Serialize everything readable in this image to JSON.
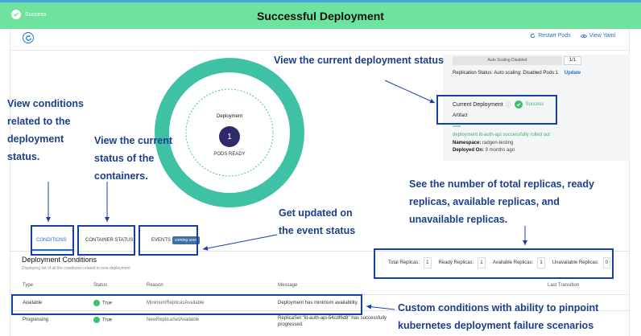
{
  "banner": {
    "status": "Success",
    "title": "Successful Deployment",
    "color": "#6ee3a0"
  },
  "toolbar": {
    "restart_pods": "Restart Pods",
    "view_yaml": "View Yaml"
  },
  "ring": {
    "label": "Deployment",
    "count": "1",
    "sublabel": "PODS READY",
    "color": "#3fc1a6"
  },
  "side": {
    "autoscaling": "Auto Scaling Disabled",
    "ratio": "1/1",
    "replication_status": "Replication Status: Auto scaling: Disabled Pods:1",
    "update": "Update",
    "current_deployment": "Current Deployment",
    "success": "Success",
    "artifact": "Artifact",
    "rolled_out": "deployment lit-auth-api successfully rolled out",
    "namespace_label": "Namespace:",
    "namespace_value": " radgen-testing",
    "deployed_on_label": "Deployed On:",
    "deployed_on_value": " 9 months ago"
  },
  "tabs": {
    "conditions": "CONDITIONS",
    "container_status": "CONTAINER STATUS",
    "events": "EVENTS",
    "coming_soon": "coming soon"
  },
  "conditions": {
    "title": "Deployment Conditions",
    "subtitle": "Displaying list of all the conditions related to new deployment"
  },
  "stats": {
    "total_label": "Total Replicas:",
    "total": "1",
    "ready_label": "Ready Replicas:",
    "ready": "1",
    "available_label": "Available Replicas:",
    "available": "1",
    "unavailable_label": "Unavailable Replicas:",
    "unavailable": "0"
  },
  "table": {
    "headers": [
      "Type",
      "Status",
      "Reason",
      "Message",
      "Last Transition"
    ],
    "rows": [
      {
        "type": "Available",
        "status": "True",
        "reason": "MinimumReplicasAvailable",
        "message": "Deployment has minimum availability."
      },
      {
        "type": "Progressing",
        "status": "True",
        "reason": "NewReplicaSetAvailable",
        "message": "ReplicaSet \"lit-auth-api-54cdf6d8\" has successfully progressed."
      }
    ]
  },
  "callouts": {
    "view_status": "View the current deployment status",
    "conditions": [
      "View conditions",
      "related to the",
      "deployment",
      "status."
    ],
    "containers": [
      "View the current",
      "status of the",
      "containers."
    ],
    "events": [
      "Get updated on",
      "the event status"
    ],
    "replicas": [
      "See the number of total replicas, ready",
      "replicas, available replicas, and",
      "unavailable replicas."
    ],
    "custom": [
      "Custom conditions with ability to pinpoint",
      "kubernetes deployment failure scenarios"
    ]
  },
  "annotation_color": "#163fa8"
}
